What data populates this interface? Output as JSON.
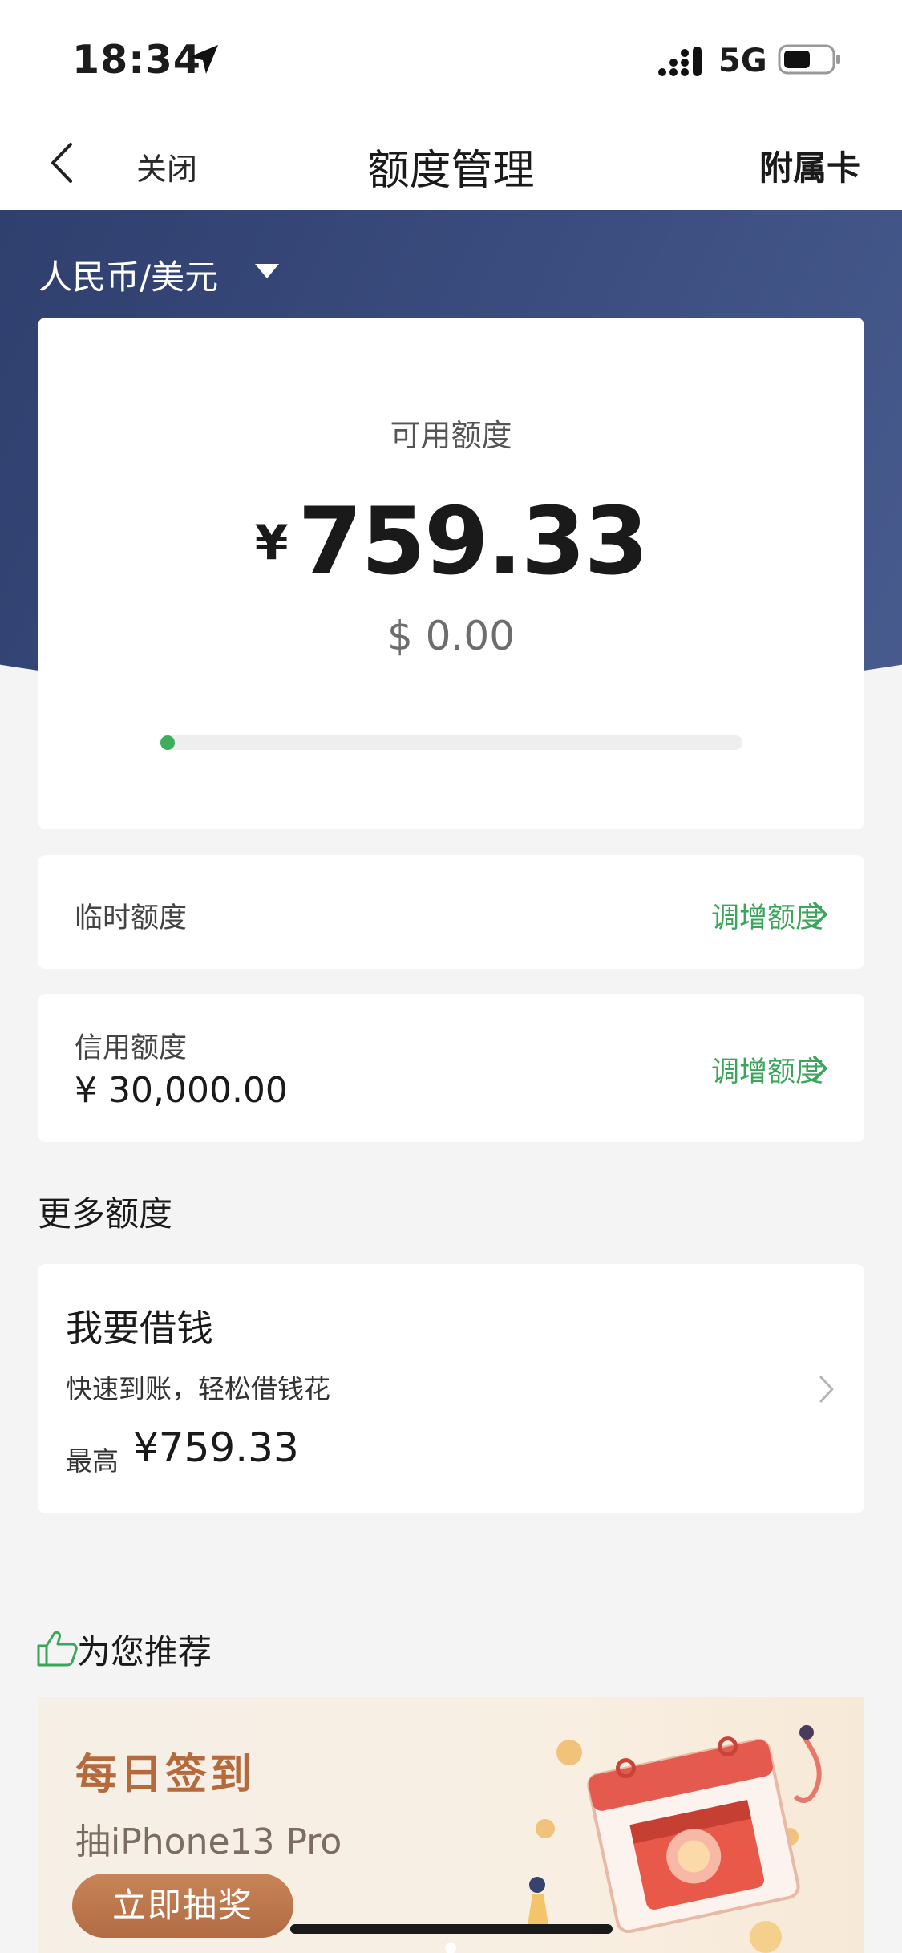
{
  "status": {
    "time": "18:34",
    "network": "5G"
  },
  "nav": {
    "close": "关闭",
    "title": "额度管理",
    "right_link": "附属卡"
  },
  "currency": {
    "selected": "人民币/美元"
  },
  "available": {
    "label": "可用额度",
    "symbol": "¥",
    "amount": "759.33",
    "usd": "$ 0.00",
    "progress_fraction": 0.025,
    "progress_color": "#3cae5c"
  },
  "temp_limit": {
    "label": "临时额度",
    "link": "调增额度"
  },
  "credit_limit": {
    "label": "信用额度",
    "value": "¥ 30,000.00",
    "link": "调增额度"
  },
  "more": {
    "title": "更多额度",
    "loan": {
      "title": "我要借钱",
      "subtitle": "快速到账，轻松借钱花",
      "max_label": "最高",
      "max_value": "¥759.33"
    }
  },
  "recommend": {
    "title": "为您推荐",
    "banner": {
      "title": "每日签到",
      "subtitle": "抽iPhone13 Pro",
      "button": "立即抽奖"
    }
  },
  "colors": {
    "accent_green": "#3aa55b",
    "hero_blue": "#394b7c",
    "banner_brown": "#b46a3c"
  }
}
